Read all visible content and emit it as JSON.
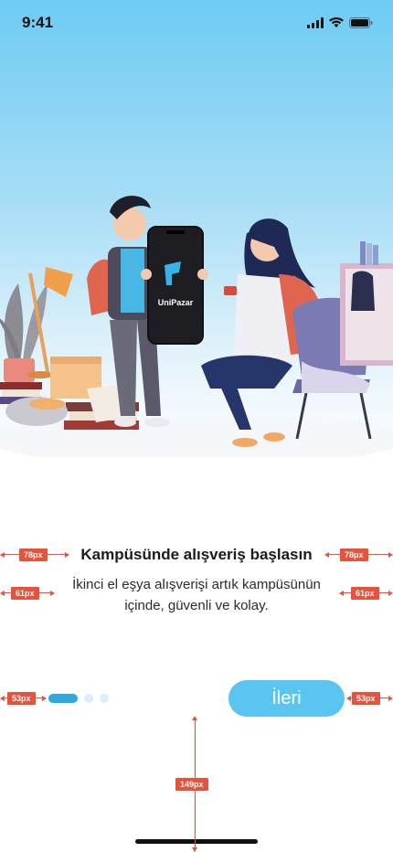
{
  "status_bar": {
    "time": "9:41",
    "icons": [
      "cellular-signal-icon",
      "wifi-icon",
      "battery-icon"
    ]
  },
  "illustration": {
    "phone_brand": "UniPazar",
    "description_icon": "students-with-phone-illustration"
  },
  "onboarding": {
    "title": "Kampüsünde alışveriş başlasın",
    "subtitle": "İkinci el eşya alışverişi artık kampüsünün içinde, güvenli ve kolay.",
    "pages_total": 3,
    "page_current": 1,
    "next_label": "İleri"
  },
  "annotations": {
    "title_margin": "78px",
    "subtitle_margin": "61px",
    "control_margin": "53px",
    "bottom_margin": "149px"
  },
  "colors": {
    "accent": "#5bc5f1",
    "dot_active": "#2ea7e6",
    "dot_inactive": "#d9eef9",
    "sky_top": "#6ecbf3",
    "annotation": "#e8513a"
  }
}
